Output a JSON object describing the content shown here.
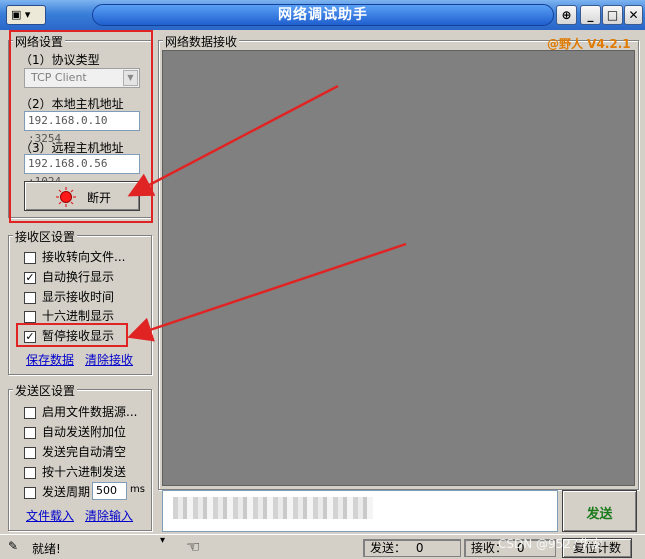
{
  "window": {
    "title": "网络调试助手",
    "sysmenu_glyph": "▾"
  },
  "net": {
    "group_title": "网络设置",
    "protocol_label": "（1）协议类型",
    "protocol_value": "TCP Client",
    "local_label": "（2）本地主机地址",
    "local_value": "192.168.0.10 :3254",
    "remote_label": "（3）远程主机地址",
    "remote_value": "192.168.0.56 :1024",
    "disconnect_label": "断开"
  },
  "recv": {
    "group_title": "接收区设置",
    "options": [
      {
        "label": "接收转向文件...",
        "checked": false
      },
      {
        "label": "自动换行显示",
        "checked": true
      },
      {
        "label": "显示接收时间",
        "checked": false
      },
      {
        "label": "十六进制显示",
        "checked": false
      },
      {
        "label": "暂停接收显示",
        "checked": true
      }
    ],
    "save_link": "保存数据",
    "clear_link": "清除接收"
  },
  "send": {
    "group_title": "发送区设置",
    "options": [
      {
        "label": "启用文件数据源...",
        "checked": false
      },
      {
        "label": "自动发送附加位",
        "checked": false
      },
      {
        "label": "发送完自动清空",
        "checked": false
      },
      {
        "label": "按十六进制发送",
        "checked": false
      }
    ],
    "period_label": "发送周期",
    "period_value": "500",
    "period_unit": "ms",
    "file_link": "文件载入",
    "clear_input_link": "清除输入",
    "send_button": "发送"
  },
  "data_panel": {
    "title": "网络数据接收",
    "brand": "@野人 V4.2.1"
  },
  "status": {
    "ready": "就绪!",
    "sent_label": "发送：",
    "sent_value": "0",
    "recv_label": "接收：",
    "recv_value": "0",
    "reset_label": "复位计数",
    "watermark": "CSDN @9527华安"
  },
  "colors": {
    "annotation_red": "#e02424",
    "send_green": "#1a7a1a",
    "brand_orange": "#e07a00"
  }
}
